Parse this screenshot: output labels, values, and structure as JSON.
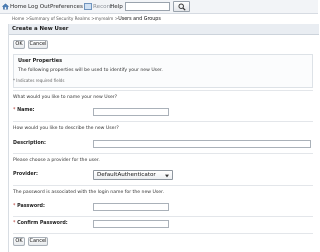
{
  "toolbar": {
    "home": "Home",
    "logout": "Log Out",
    "preferences": "Preferences",
    "record": "Record",
    "help": "Help",
    "search_value": ""
  },
  "breadcrumb": {
    "path": "Home >Summary of Security Realms >myrealm >",
    "current": "Users and Groups"
  },
  "page": {
    "title": "Create a New User",
    "ok": "OK",
    "cancel": "Cancel"
  },
  "properties": {
    "heading": "User Properties",
    "intro": "The following properties will be used to identify your new User.",
    "required_note": "* Indicates required fields"
  },
  "form": {
    "name_question": "What would you like to name your new User?",
    "name_label": "Name:",
    "name_value": "",
    "desc_question": "How would you like to describe the new User?",
    "desc_label": "Description:",
    "desc_value": "",
    "provider_question": "Please choose a provider for the user.",
    "provider_label": "Provider:",
    "provider_value": "DefaultAuthenticator",
    "password_question": "The password is associated with the login name for the new User.",
    "password_label": "Password:",
    "password_value": "",
    "confirm_label": "Confirm Password:",
    "confirm_value": "",
    "required_mark": "*"
  },
  "colors": {
    "toolbar_bg": "#f2f4f7",
    "title_bg": "#e9edf2",
    "required": "#b0302a"
  }
}
